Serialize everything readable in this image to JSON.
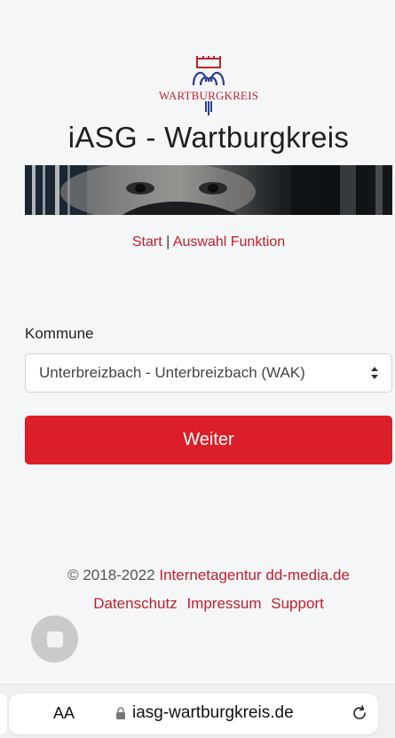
{
  "header": {
    "logo_text": "WARTBURGKREIS",
    "title": "iASG - Wartburgkreis"
  },
  "nav": {
    "start_label": "Start",
    "separator": " | ",
    "auswahl_label": "Auswahl Funktion"
  },
  "form": {
    "kommune_label": "Kommune",
    "kommune_value": "Unterbreizbach - Unterbreizbach (WAK)",
    "submit_label": "Weiter"
  },
  "footer": {
    "copyright": "© 2018-2022 ",
    "agency_link": "Internetagentur dd-media.de",
    "links": [
      "Datenschutz",
      "Impressum",
      "Support"
    ]
  },
  "browser": {
    "text_size_label": "AA",
    "url": "iasg-wartburgkreis.de"
  },
  "colors": {
    "accent_red": "#dc1e28",
    "link_red": "#c0202a",
    "background": "#f5f6f8"
  }
}
